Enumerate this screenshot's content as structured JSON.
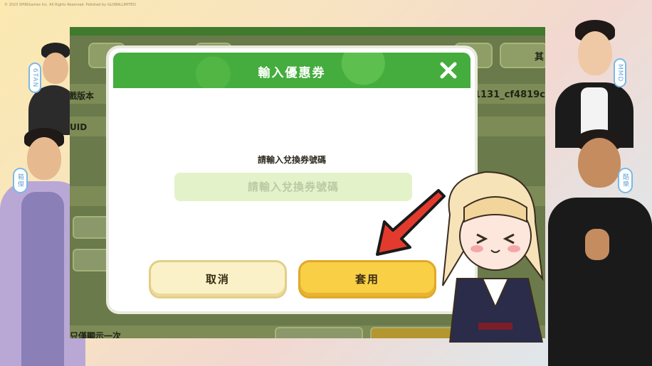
{
  "copyright": "© 2023 SPIRIGames Inc. All Rights Reserved.   Polished by GLOBALLIMITED",
  "game_background": {
    "version_label": "遊戲版本",
    "version_value": "1131_cf4819c6",
    "uid_label": "UID",
    "bottom_label": "只僅顯示一次",
    "top_right_tab": "其"
  },
  "name_tags": {
    "left_top": "6TAN",
    "left_middle": "箱傑",
    "right_top": "MMD",
    "right_middle": "酷樂"
  },
  "dialog": {
    "title": "輸入優惠券",
    "prompt": "請輸入兌換券號碼",
    "input_placeholder": "請輸入兌換券號碼",
    "input_value": "",
    "cancel_label": "取消",
    "apply_label": "套用"
  },
  "colors": {
    "header_green": "#44ad3d",
    "apply_yellow": "#f8cf45",
    "cancel_cream": "#fbf1c8",
    "arrow_red": "#e23b2e"
  },
  "icons": {
    "close": "close-icon",
    "arrow": "red-arrow-icon"
  }
}
